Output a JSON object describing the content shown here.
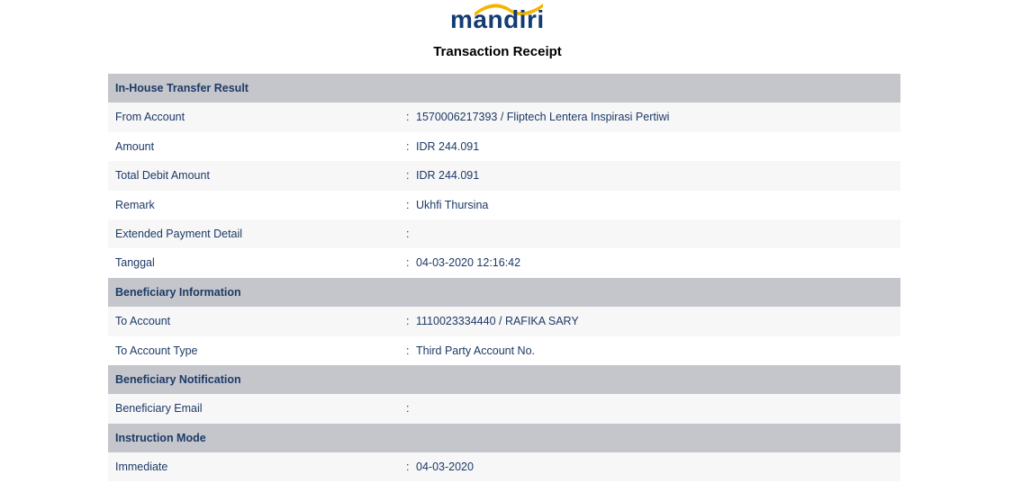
{
  "logo": {
    "text": "mandiri"
  },
  "title": "Transaction Receipt",
  "sections": [
    {
      "header": "In-House Transfer Result",
      "rows": [
        {
          "label": "From Account",
          "value": "1570006217393 / Fliptech Lentera Inspirasi Pertiwi"
        },
        {
          "label": "Amount",
          "value": "IDR 244.091"
        },
        {
          "label": "Total Debit Amount",
          "value": "IDR 244.091"
        },
        {
          "label": "Remark",
          "value": "Ukhfi Thursina"
        },
        {
          "label": "Extended Payment Detail",
          "value": ""
        },
        {
          "label": "Tanggal",
          "value": "04-03-2020 12:16:42"
        }
      ]
    },
    {
      "header": "Beneficiary Information",
      "rows": [
        {
          "label": "To Account",
          "value": "1110023334440 / RAFIKA SARY"
        },
        {
          "label": "To Account Type",
          "value": "Third Party Account No."
        }
      ]
    },
    {
      "header": "Beneficiary Notification",
      "rows": [
        {
          "label": "Beneficiary Email",
          "value": ""
        }
      ]
    },
    {
      "header": "Instruction Mode",
      "rows": [
        {
          "label": "Immediate",
          "value": "04-03-2020"
        }
      ]
    }
  ],
  "separator": ":",
  "colors": {
    "brand_blue": "#123c73",
    "brand_gold": "#f5b400",
    "header_bg": "#c4c6cc"
  }
}
